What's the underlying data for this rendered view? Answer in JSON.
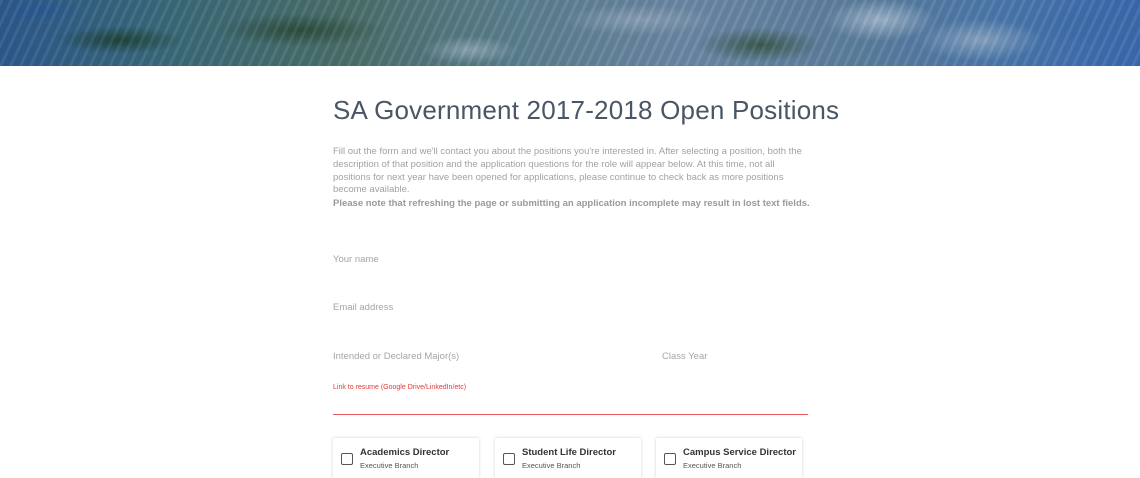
{
  "hero": {
    "image_name": "aerial-campus-photo"
  },
  "page": {
    "title": "SA Government 2017-2018 Open Positions",
    "intro": "Fill out the form and we'll contact you about the positions you're interested in. After selecting a position, both the description of that position and the application questions for the role will appear below. At this time, not all positions for next year have been opened for applications, please continue to check back as more positions become available.",
    "note": "Please note that refreshing the page or submitting an application incomplete may result in lost text fields."
  },
  "form": {
    "name_placeholder": "Your name",
    "email_placeholder": "Email address",
    "major_placeholder": "Intended or Declared Major(s)",
    "year_placeholder": "Class Year",
    "resume_label": "Link to resume (Google Drive/LinkedIn/etc)",
    "resume_value": "",
    "accent_color": "#e23a3a"
  },
  "positions": [
    {
      "title": "Academics Director",
      "branch": "Executive Branch",
      "checked": false
    },
    {
      "title": "Student Life Director",
      "branch": "Executive Branch",
      "checked": false
    },
    {
      "title": "Campus Service Director",
      "branch": "Executive Branch",
      "checked": false
    }
  ]
}
